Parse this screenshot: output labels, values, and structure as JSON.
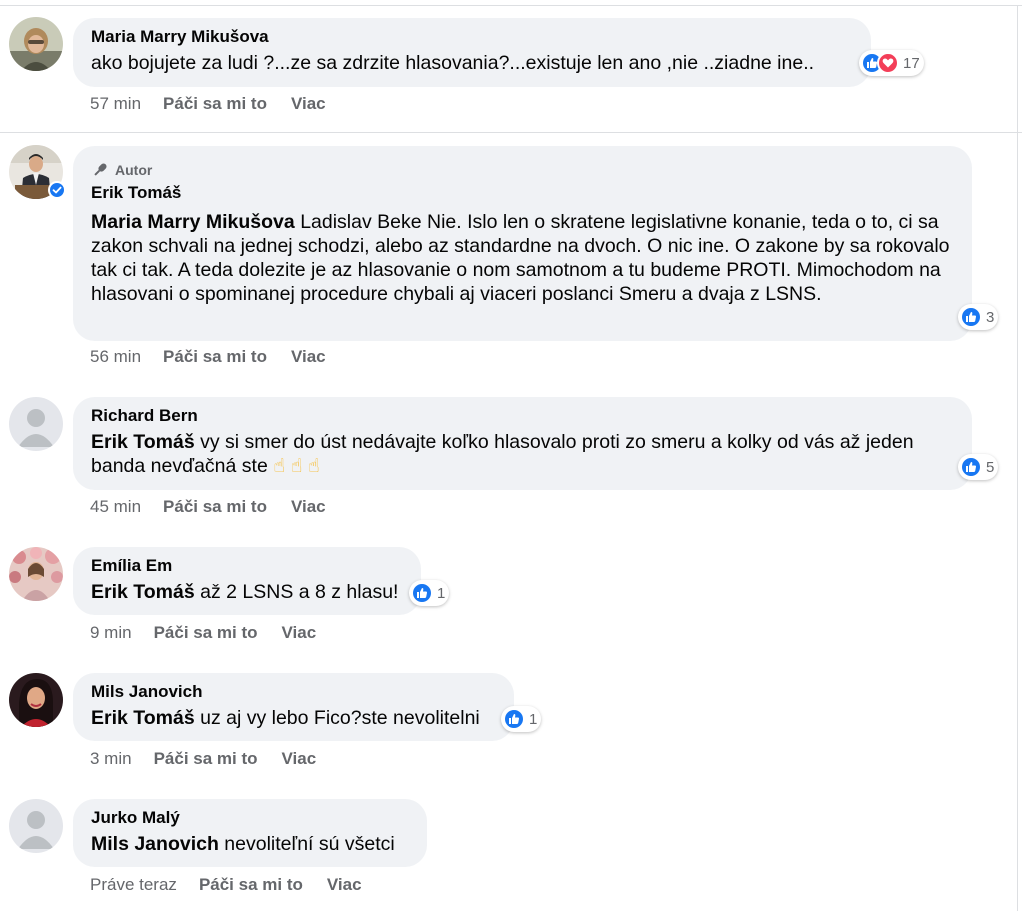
{
  "comments": [
    {
      "author": "Maria Marry Mikušova",
      "text": "ako bojujete za ludi ?...ze sa zdrzite hlasovania?...existuje len ano ,nie ..ziadne ine..",
      "reactions": {
        "types": [
          "like-icon",
          "love-icon"
        ],
        "count": "17"
      },
      "time": "57 min",
      "like_label": "Páči sa mi to",
      "more_label": "Viac"
    },
    {
      "badge": "Autor",
      "author": "Erik Tomáš",
      "verified": true,
      "mention": "Maria Marry Mikušova",
      "text": "Ladislav Beke Nie. Islo len o skratene legislativne konanie, teda o to, ci sa zakon schvali na jednej schodzi, alebo az standardne na dvoch. O nic ine. O zakone by sa rokovalo tak ci tak. A teda dolezite je az hlasovanie o nom samotnom a tu budeme PROTI. Mimochodom na hlasovani o spominanej procedure chybali aj viaceri poslanci Smeru a dvaja z LSNS.",
      "reactions": {
        "types": [
          "like-icon"
        ],
        "count": "3"
      },
      "time": "56 min",
      "like_label": "Páči sa mi to",
      "more_label": "Viac"
    },
    {
      "author": "Richard Bern",
      "mention": "Erik Tomáš",
      "text": "vy si smer do úst nedávajte koľko hlasovalo proti zo smeru a kolky od vás až jeden banda nevďačná ste",
      "emoji": "☝ ☝ ☝",
      "reactions": {
        "types": [
          "like-icon"
        ],
        "count": "5"
      },
      "time": "45 min",
      "like_label": "Páči sa mi to",
      "more_label": "Viac"
    },
    {
      "author": "Emília Em",
      "mention": "Erik Tomáš",
      "text": "až 2 LSNS a 8 z hlasu!",
      "reactions": {
        "types": [
          "like-icon"
        ],
        "count": "1"
      },
      "time": "9 min",
      "like_label": "Páči sa mi to",
      "more_label": "Viac"
    },
    {
      "author": "Mils Janovich",
      "mention": "Erik Tomáš",
      "text": "uz aj vy lebo Fico?ste nevolitelni",
      "reactions": {
        "types": [
          "like-icon"
        ],
        "count": "1"
      },
      "time": "3 min",
      "like_label": "Páči sa mi to",
      "more_label": "Viac"
    },
    {
      "author": "Jurko Malý",
      "mention": "Mils Janovich",
      "text": "nevoliteľní sú všetci",
      "time": "Práve teraz",
      "like_label": "Páči sa mi to",
      "more_label": "Viac"
    }
  ],
  "colors": {
    "bubble": "#f0f2f5",
    "meta": "#65676b",
    "like": "#1877f2",
    "love": "#f33e58",
    "emoji": "#f7b928"
  }
}
